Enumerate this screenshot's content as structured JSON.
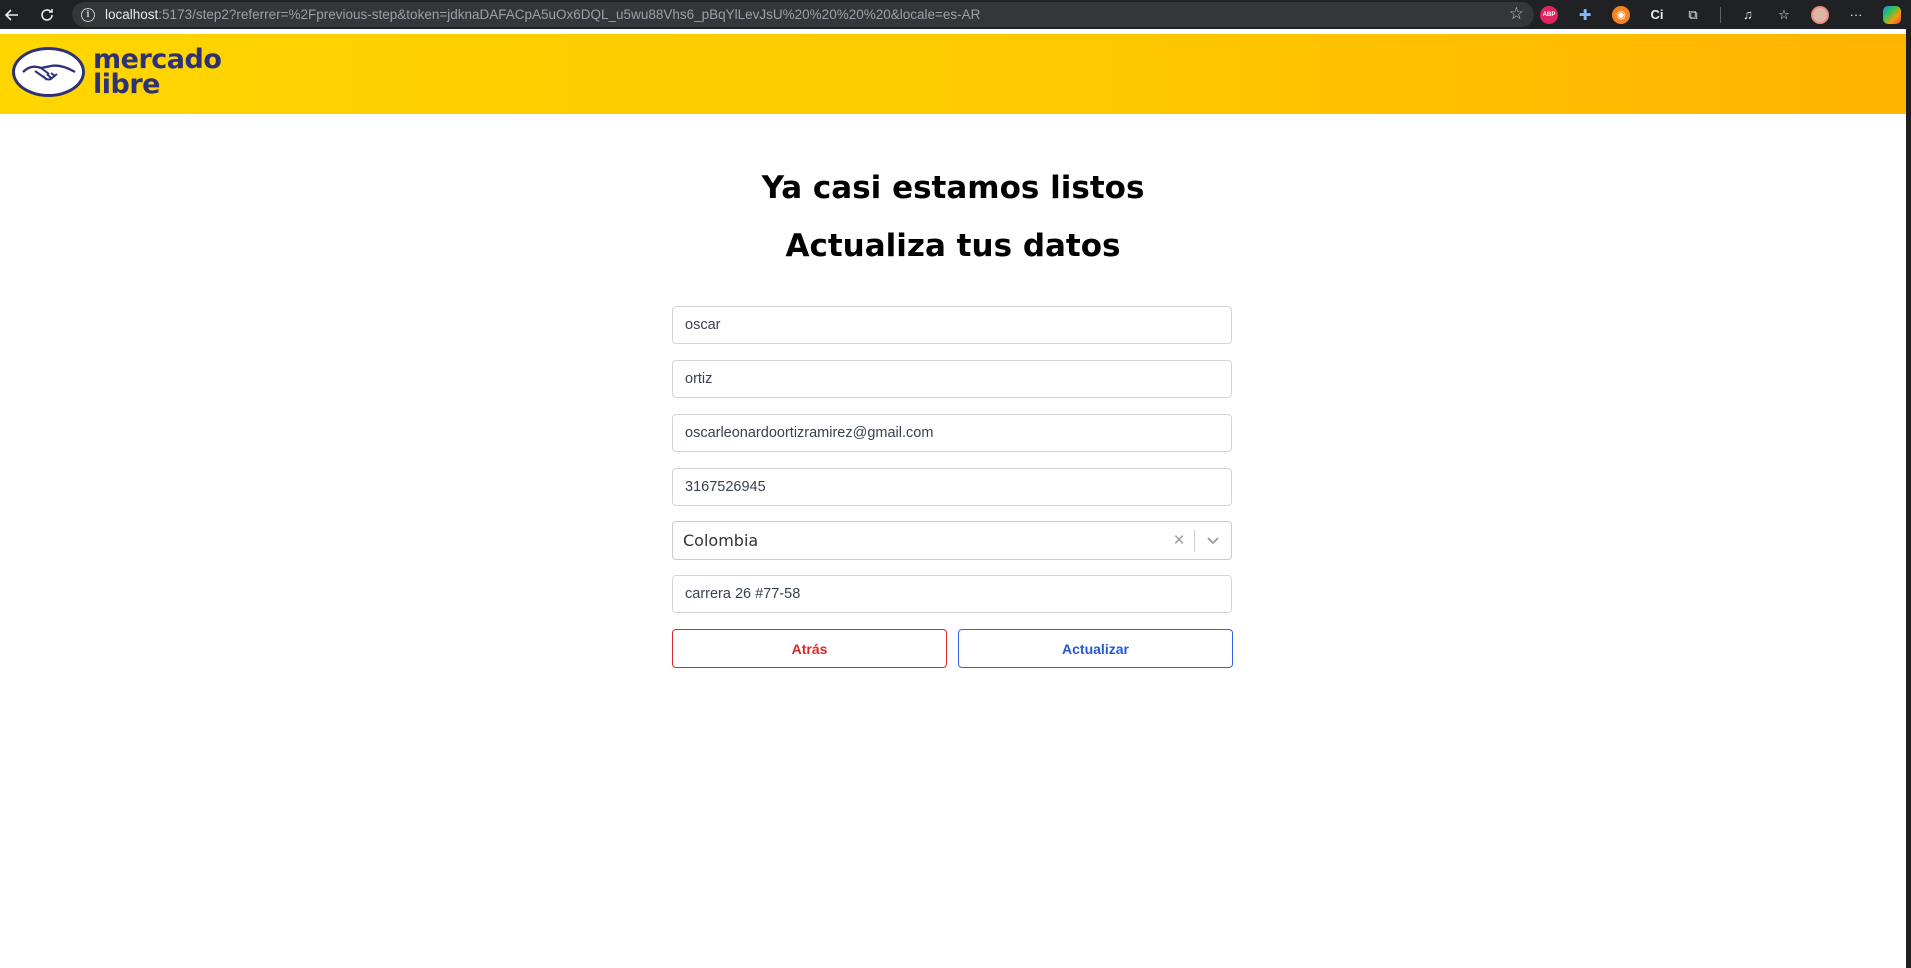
{
  "browser": {
    "url_host": "localhost",
    "url_rest": ":5173/step2?referrer=%2Fprevious-step&token=jdknaDAFACpA5uOx6DQL_u5wu88Vhs6_pBqYlLevJsU%20%20%20%20&locale=es-AR",
    "icons": [
      "back-icon",
      "reload-icon",
      "info-icon",
      "star-icon",
      "abp-icon",
      "extension-icon",
      "rss-icon",
      "ci-icon",
      "puzzle-icon",
      "media-icon",
      "favorites-icon",
      "profile-avatar",
      "more-icon",
      "copilot-icon"
    ],
    "abp_label": "ABP"
  },
  "header": {
    "logo_line1": "mercado",
    "logo_line2": "libre",
    "background": "#ffd600"
  },
  "main": {
    "title_line1": "Ya casi estamos listos",
    "title_line2": "Actualiza tus datos",
    "fields": {
      "first_name": "oscar",
      "last_name": "ortiz",
      "email": "oscarleonardoortizramirez@gmail.com",
      "phone": "3167526945",
      "country": "Colombia",
      "address": "carrera 26 #77-58"
    },
    "back_label": "Atrás",
    "update_label": "Actualizar",
    "back_color": "#dc2626",
    "update_color": "#2557d6"
  }
}
